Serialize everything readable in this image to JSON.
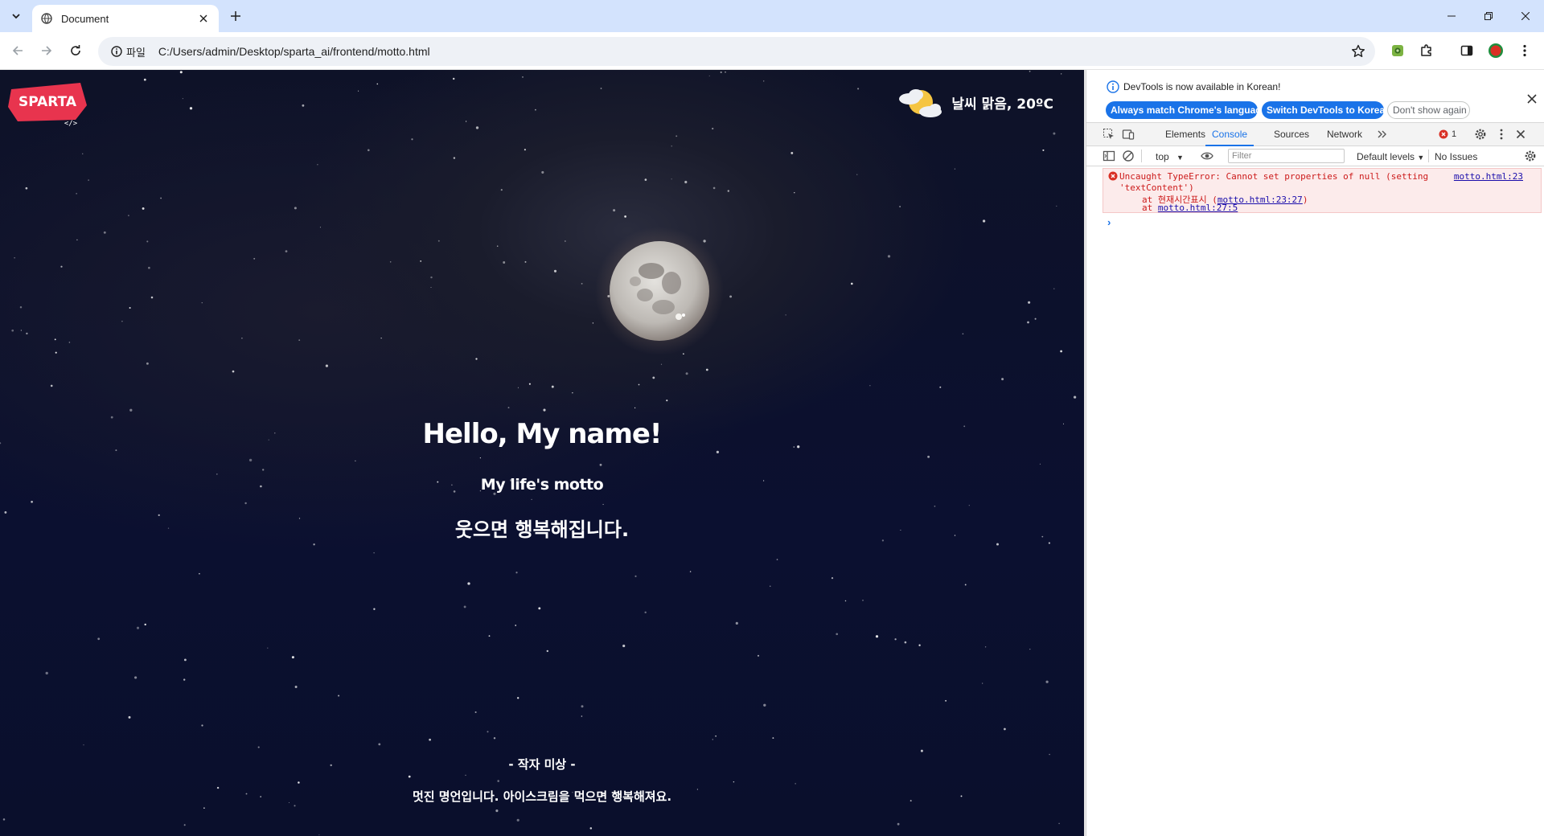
{
  "browser": {
    "tab_title": "Document",
    "site_info_label": "파일",
    "url": "C:/Users/admin/Desktop/sparta_ai/frontend/motto.html"
  },
  "page": {
    "logo_text": "SPARTA",
    "weather_text": "날씨 맑음, 20ºC",
    "title": "Hello, My name!",
    "subtitle": "My life's motto",
    "motto": "웃으면 행복해집니다.",
    "author": "- 작자 미상 -",
    "quote": "멋진 명언입니다. 아이스크림을 먹으면 행복해져요."
  },
  "devtools": {
    "banner_message": "DevTools is now available in Korean!",
    "btn_match_language": "Always match Chrome's language",
    "btn_switch_korean": "Switch DevTools to Korean",
    "btn_dont_show": "Don't show again",
    "tabs": [
      "Elements",
      "Console",
      "Sources",
      "Network"
    ],
    "active_tab": "Console",
    "error_count": "1",
    "context": "top",
    "filter_placeholder": "Filter",
    "levels": "Default levels",
    "issues": "No Issues",
    "error": {
      "line1": "Uncaught TypeError: Cannot set properties of null (setting",
      "line2": "'textContent')",
      "line3_prefix": "at 현재시간표시 (",
      "line3_link": "motto.html:23:27",
      "line3_suffix": ")",
      "line4_prefix": "at ",
      "line4_link": "motto.html:27:5",
      "source": "motto.html:23"
    },
    "prompt": "›"
  },
  "colors": {
    "tabstrip_bg": "#d3e3fd",
    "accent_blue": "#1a73e8",
    "logo_red": "#e8344e",
    "error_red": "#cc1a1a",
    "error_bg": "#fcebeb"
  }
}
